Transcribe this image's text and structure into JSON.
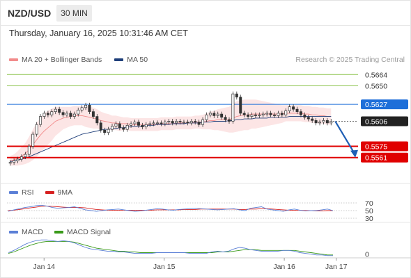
{
  "header": {
    "symbol": "NZD/USD",
    "interval": "30 MIN",
    "datetime": "Thursday, January 16, 2025 10:31:46 AM CET"
  },
  "legend_main": {
    "ma20": "MA 20 + Bollinger Bands",
    "ma50": "MA 50",
    "ma20_color": "#f28b8b",
    "ma50_color": "#1f3f7a"
  },
  "copyright": "Research © 2025 Trading Central",
  "legend_rsi": {
    "rsi": "RSI",
    "ma9": "9MA",
    "rsi_color": "#5b7fd6",
    "ma9_color": "#d62020"
  },
  "legend_macd": {
    "macd": "MACD",
    "signal": "MACD Signal",
    "macd_color": "#5b7fd6",
    "signal_color": "#3a9a1a"
  },
  "chart_data": [
    {
      "type": "candlestick",
      "title": "NZD/USD 30 MIN",
      "price_range": [
        0.5553,
        0.5672
      ],
      "x_ticks": [
        "Jan 14",
        "Jan 15",
        "Jan 16",
        "Jan 17"
      ],
      "levels": [
        {
          "value": 0.5664,
          "label": "0.5664",
          "kind": "resistance",
          "color": "#8bc34a"
        },
        {
          "value": 0.565,
          "label": "0.5650",
          "kind": "resistance",
          "color": "#8bc34a"
        },
        {
          "value": 0.5627,
          "label": "0.5627",
          "kind": "pivot",
          "color": "#1e6fd9"
        },
        {
          "value": 0.5606,
          "label": "0.5606",
          "kind": "last-price",
          "color": "#222222"
        },
        {
          "value": 0.5575,
          "label": "0.5575",
          "kind": "support",
          "color": "#e00000"
        },
        {
          "value": 0.5561,
          "label": "0.5561",
          "kind": "support",
          "color": "#e00000"
        }
      ],
      "last_price": 0.5606,
      "closes": [
        0.5555,
        0.5557,
        0.5559,
        0.5562,
        0.5565,
        0.5575,
        0.559,
        0.5602,
        0.5612,
        0.5616,
        0.5614,
        0.5618,
        0.5621,
        0.5617,
        0.5614,
        0.5616,
        0.5612,
        0.5615,
        0.562,
        0.5623,
        0.5626,
        0.5618,
        0.5612,
        0.5604,
        0.5595,
        0.5592,
        0.5596,
        0.56,
        0.5603,
        0.5598,
        0.5596,
        0.5601,
        0.5603,
        0.5605,
        0.5601,
        0.5599,
        0.5602,
        0.5603,
        0.5604,
        0.5604,
        0.5603,
        0.5605,
        0.5606,
        0.5604,
        0.5606,
        0.5605,
        0.5605,
        0.5604,
        0.5606,
        0.5605,
        0.5602,
        0.5608,
        0.5614,
        0.5616,
        0.5613,
        0.5615,
        0.5611,
        0.5608,
        0.5606,
        0.564,
        0.5636,
        0.5616,
        0.5614,
        0.5612,
        0.5614,
        0.5613,
        0.5614,
        0.5615,
        0.5616,
        0.5614,
        0.5613,
        0.5616,
        0.5614,
        0.5619,
        0.5624,
        0.5621,
        0.5618,
        0.5614,
        0.5611,
        0.5609,
        0.5607,
        0.5604,
        0.5605,
        0.5607,
        0.5604,
        0.5606
      ],
      "opens": [
        0.5554,
        0.5555,
        0.5557,
        0.5559,
        0.5562,
        0.5565,
        0.5575,
        0.559,
        0.5602,
        0.5612,
        0.5616,
        0.5614,
        0.5618,
        0.5621,
        0.5617,
        0.5614,
        0.5616,
        0.5612,
        0.5615,
        0.562,
        0.5623,
        0.5626,
        0.5618,
        0.5612,
        0.5604,
        0.5595,
        0.5592,
        0.5596,
        0.56,
        0.5603,
        0.5598,
        0.5596,
        0.5601,
        0.5603,
        0.5605,
        0.5601,
        0.5599,
        0.5602,
        0.5603,
        0.5604,
        0.5604,
        0.5603,
        0.5605,
        0.5606,
        0.5604,
        0.5606,
        0.5605,
        0.5605,
        0.5604,
        0.5606,
        0.5605,
        0.5602,
        0.5608,
        0.5614,
        0.5616,
        0.5613,
        0.5615,
        0.5611,
        0.5608,
        0.5606,
        0.564,
        0.5636,
        0.5616,
        0.5614,
        0.5612,
        0.5614,
        0.5613,
        0.5614,
        0.5615,
        0.5616,
        0.5614,
        0.5613,
        0.5616,
        0.5614,
        0.5619,
        0.5624,
        0.5621,
        0.5618,
        0.5614,
        0.5611,
        0.5609,
        0.5607,
        0.5604,
        0.5605,
        0.5607,
        0.5604
      ],
      "ma20": [
        0.5557,
        0.5558,
        0.556,
        0.5563,
        0.5566,
        0.5571,
        0.5577,
        0.5583,
        0.5589,
        0.5594,
        0.5598,
        0.5602,
        0.5606,
        0.5608,
        0.561,
        0.5611,
        0.5612,
        0.5613,
        0.5613,
        0.5613,
        0.5612,
        0.5611,
        0.561,
        0.5609,
        0.5607,
        0.5606,
        0.5605,
        0.5604,
        0.5604,
        0.5603,
        0.5603,
        0.5603,
        0.5602,
        0.5602,
        0.5602,
        0.5602,
        0.5602,
        0.5602,
        0.5602,
        0.5602,
        0.5603,
        0.5603,
        0.5603,
        0.5603,
        0.5604,
        0.5604,
        0.5604,
        0.5604,
        0.5604,
        0.5605,
        0.5605,
        0.5605,
        0.5606,
        0.5607,
        0.5607,
        0.5608,
        0.5608,
        0.5608,
        0.5608,
        0.561,
        0.5612,
        0.5613,
        0.5614,
        0.5614,
        0.5615,
        0.5615,
        0.5615,
        0.5615,
        0.5615,
        0.5615,
        0.5615,
        0.5615,
        0.5615,
        0.5616,
        0.5616,
        0.5616,
        0.5616,
        0.5616,
        0.5615,
        0.5615,
        0.5614,
        0.5614,
        0.5613,
        0.5613,
        0.5612,
        0.5612
      ],
      "ma50": [
        0.5556,
        0.5557,
        0.5558,
        0.5559,
        0.556,
        0.5562,
        0.5564,
        0.5566,
        0.5568,
        0.557,
        0.5572,
        0.5574,
        0.5576,
        0.5578,
        0.558,
        0.5582,
        0.5584,
        0.5586,
        0.5588,
        0.559,
        0.5591,
        0.5592,
        0.5593,
        0.5594,
        0.5595,
        0.5596,
        0.5596,
        0.5597,
        0.5597,
        0.5598,
        0.5598,
        0.5599,
        0.5599,
        0.56,
        0.56,
        0.56,
        0.5601,
        0.5601,
        0.5601,
        0.5602,
        0.5602,
        0.5602,
        0.5602,
        0.5603,
        0.5603,
        0.5603,
        0.5603,
        0.5604,
        0.5604,
        0.5604,
        0.5604,
        0.5605,
        0.5605,
        0.5605,
        0.5606,
        0.5606,
        0.5606,
        0.5606,
        0.5607,
        0.5607,
        0.5608,
        0.5608,
        0.5609,
        0.5609,
        0.5609,
        0.561,
        0.561,
        0.561,
        0.561,
        0.5611,
        0.5611,
        0.5611,
        0.5611,
        0.5611,
        0.5612,
        0.5612,
        0.5612,
        0.5612,
        0.5612,
        0.5612,
        0.5612,
        0.5612,
        0.5612,
        0.5612,
        0.5612,
        0.5612
      ],
      "band_width": [
        0.0006,
        0.0007,
        0.0009,
        0.0011,
        0.0013,
        0.0016,
        0.0019,
        0.0021,
        0.0022,
        0.0022,
        0.0021,
        0.002,
        0.0018,
        0.0016,
        0.0014,
        0.0013,
        0.0012,
        0.0012,
        0.0012,
        0.0012,
        0.0013,
        0.0013,
        0.0013,
        0.0012,
        0.0011,
        0.001,
        0.001,
        0.0009,
        0.0009,
        0.0009,
        0.0008,
        0.0008,
        0.0008,
        0.0008,
        0.0008,
        0.0008,
        0.0008,
        0.0008,
        0.0008,
        0.0008,
        0.0008,
        0.0008,
        0.0008,
        0.0008,
        0.0008,
        0.0008,
        0.0008,
        0.0008,
        0.0008,
        0.0008,
        0.0008,
        0.0009,
        0.001,
        0.0011,
        0.0012,
        0.0013,
        0.0014,
        0.0015,
        0.0016,
        0.0018,
        0.0019,
        0.0019,
        0.0019,
        0.0019,
        0.0018,
        0.0018,
        0.0017,
        0.0016,
        0.0015,
        0.0014,
        0.0013,
        0.0012,
        0.0011,
        0.001,
        0.001,
        0.001,
        0.001,
        0.001,
        0.001,
        0.001,
        0.001,
        0.001,
        0.001,
        0.001,
        0.001,
        0.001
      ]
    },
    {
      "type": "line",
      "title": "RSI",
      "ylim": [
        30,
        70
      ],
      "y_ticks": [
        70,
        50,
        30
      ],
      "series": [
        {
          "name": "RSI",
          "values": [
            48,
            52,
            55,
            58,
            60,
            63,
            64,
            62,
            58,
            56,
            57,
            58,
            60,
            56,
            52,
            50,
            48,
            50,
            52,
            53,
            54,
            52,
            50,
            48,
            49,
            51,
            53,
            55,
            54,
            52,
            51,
            53,
            54,
            55,
            56,
            55,
            54,
            53,
            52,
            53,
            54,
            55,
            52,
            50,
            56,
            58,
            60,
            54,
            52,
            50,
            48,
            52,
            54,
            51,
            49,
            50,
            50,
            52,
            54,
            50
          ]
        },
        {
          "name": "9MA",
          "values": [
            50,
            51,
            53,
            55,
            57,
            59,
            61,
            62,
            61,
            60,
            59,
            58,
            58,
            58,
            57,
            55,
            53,
            52,
            51,
            51,
            51,
            51,
            51,
            51,
            51,
            51,
            51,
            52,
            52,
            52,
            52,
            52,
            53,
            53,
            53,
            54,
            54,
            54,
            54,
            54,
            54,
            54,
            53,
            53,
            54,
            54,
            55,
            55,
            54,
            53,
            52,
            51,
            51,
            51,
            50,
            50,
            49,
            49,
            50,
            50
          ]
        }
      ]
    },
    {
      "type": "line",
      "title": "MACD",
      "ylim": [
        -0.0004,
        0.0022
      ],
      "y_ticks": [
        0
      ],
      "series": [
        {
          "name": "MACD",
          "values": [
            0.0002,
            0.0005,
            0.0009,
            0.0013,
            0.0016,
            0.0018,
            0.0019,
            0.0019,
            0.0018,
            0.0017,
            0.0018,
            0.0017,
            0.0015,
            0.0012,
            0.0009,
            0.0007,
            0.0006,
            0.0005,
            0.0004,
            0.0004,
            0.0003,
            0.0003,
            0.0002,
            0.0001,
            0.0001,
            0.0001,
            0.0001,
            0.0002,
            0.0002,
            0.0002,
            0.0002,
            0.0002,
            0.0002,
            0.0001,
            0.0001,
            0.0001,
            0.0001,
            0.0003,
            0.0004,
            0.0003,
            0.0004,
            0.0007,
            0.0009,
            0.0008,
            0.0006,
            0.0005,
            0.0004,
            0.0004,
            0.0004,
            0.0004,
            0.0005,
            0.0005,
            0.0004,
            0.0002,
            0.0001,
            0.0,
            -0.0001,
            -0.0001,
            -0.0002,
            -0.0002
          ]
        },
        {
          "name": "MACD Signal",
          "values": [
            0.0001,
            0.0003,
            0.0006,
            0.0009,
            0.0012,
            0.0014,
            0.0016,
            0.0017,
            0.0017,
            0.0017,
            0.0017,
            0.0017,
            0.0016,
            0.0014,
            0.0012,
            0.001,
            0.0008,
            0.0007,
            0.0006,
            0.0005,
            0.0004,
            0.0004,
            0.0003,
            0.0003,
            0.0002,
            0.0002,
            0.0002,
            0.0002,
            0.0002,
            0.0002,
            0.0002,
            0.0002,
            0.0002,
            0.0002,
            0.0002,
            0.0002,
            0.0002,
            0.0002,
            0.0003,
            0.0003,
            0.0003,
            0.0004,
            0.0005,
            0.0006,
            0.0006,
            0.0006,
            0.0005,
            0.0005,
            0.0005,
            0.0005,
            0.0005,
            0.0005,
            0.0005,
            0.0004,
            0.0003,
            0.0002,
            0.0001,
            0.0,
            -0.0001,
            -0.0001
          ]
        }
      ]
    }
  ]
}
